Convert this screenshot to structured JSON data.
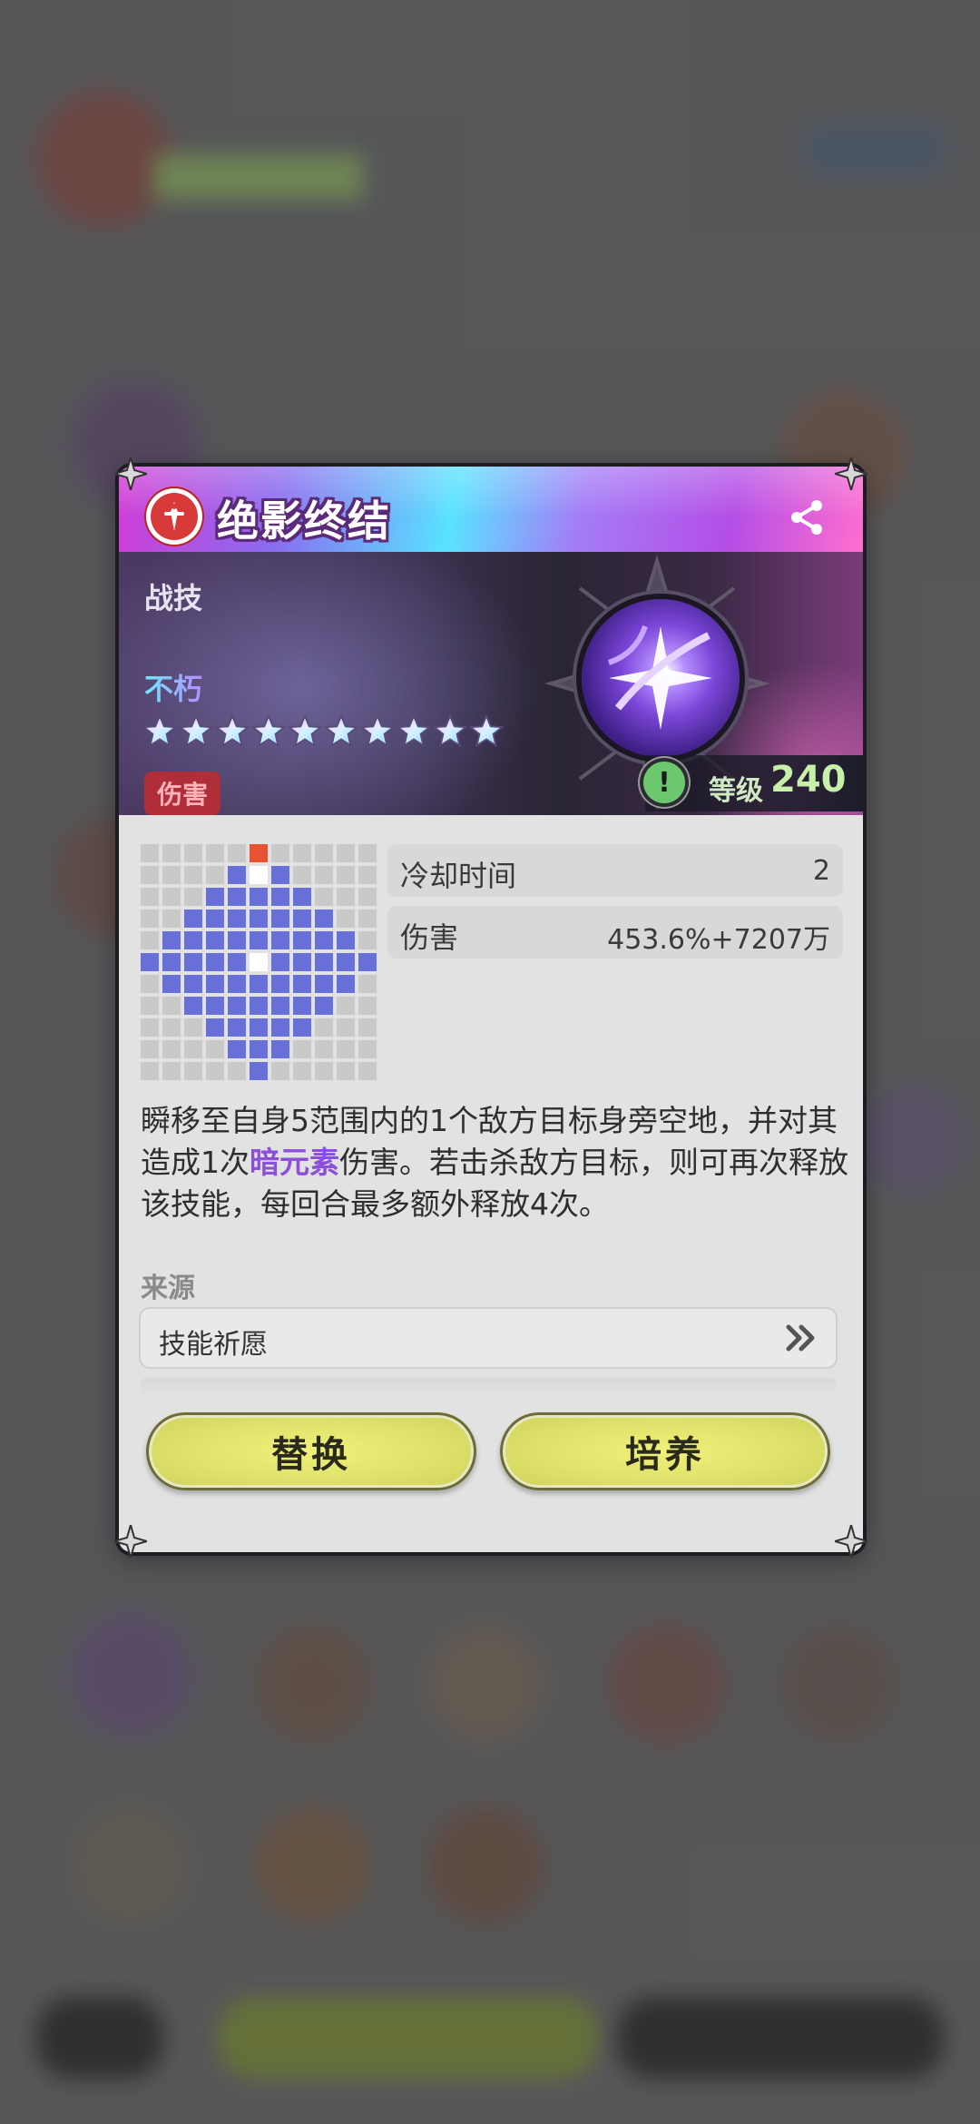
{
  "skill": {
    "name": "绝影终结",
    "type": "战技",
    "rank_name": "不朽",
    "star_count": 10,
    "tag": "伤害",
    "level_label": "等级",
    "level_value": "240"
  },
  "stats": [
    {
      "label": "冷却时间",
      "value": "2"
    },
    {
      "label": "伤害",
      "value": "453.6%+7207万"
    }
  ],
  "description": {
    "part1": "瞬移至自身5范围内的1个敌方目标身旁空地，并对其造成1次",
    "highlight": "暗元素",
    "part2": "伤害。若击杀敌方目标，则可再次释放该技能，每回合最多额外释放4次。"
  },
  "source": {
    "label": "来源",
    "item": "技能祈愿"
  },
  "buttons": {
    "replace": "替换",
    "upgrade": "培养"
  },
  "icons": {
    "share": "share-icon",
    "info": "info-icon",
    "forward": "double-chevron-right-icon"
  },
  "colors": {
    "range_fill": "#6770d6",
    "range_empty": "#c9c9c9",
    "range_origin": "#ffffff",
    "range_caster": "#e85232",
    "highlight": "#8b4fd8",
    "button": "#dfe36b"
  }
}
